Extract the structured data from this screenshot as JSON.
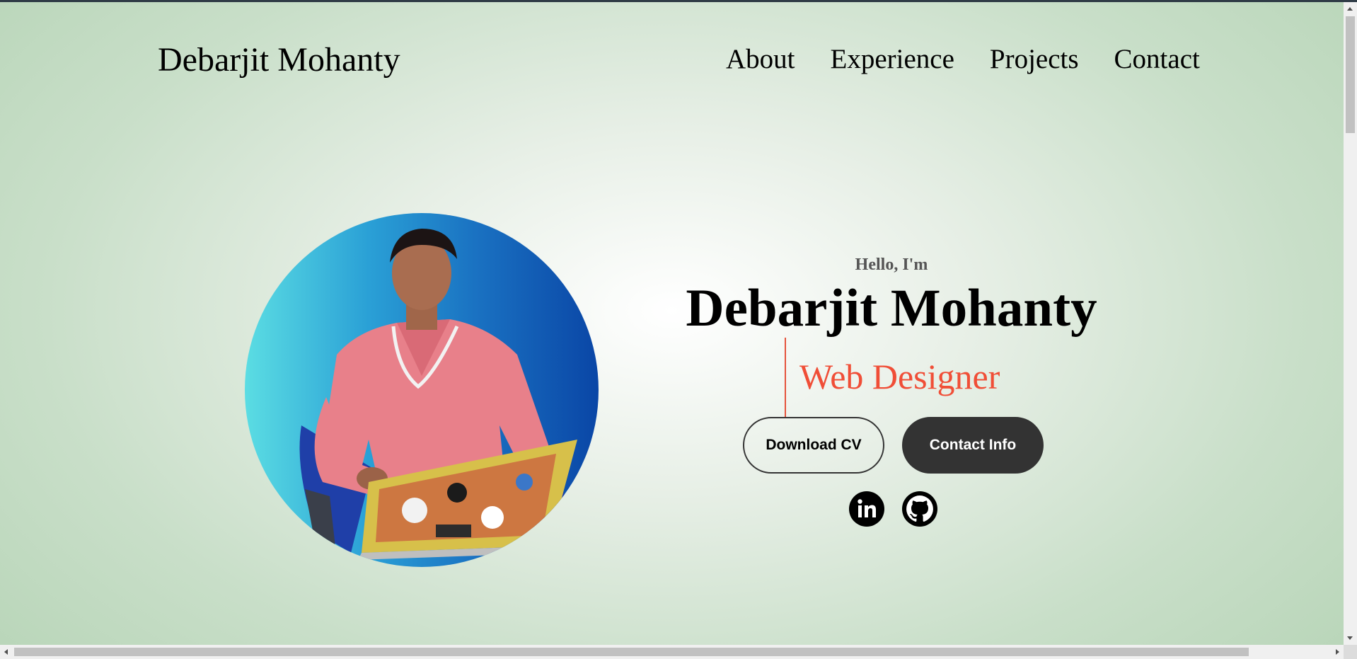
{
  "header": {
    "logo": "Debarjit Mohanty",
    "nav": [
      "About",
      "Experience",
      "Projects",
      "Contact"
    ]
  },
  "hero": {
    "greeting": "Hello, I'm",
    "name": "Debarjit Mohanty",
    "role": "Web Designer",
    "buttons": {
      "download_cv": "Download CV",
      "contact_info": "Contact Info"
    },
    "social": [
      "linkedin-icon",
      "github-icon"
    ]
  },
  "colors": {
    "accent": "#f04e37",
    "button_dark": "#333333",
    "photo_gradient_start": "#5bdde3",
    "photo_gradient_end": "#0a46a6"
  }
}
